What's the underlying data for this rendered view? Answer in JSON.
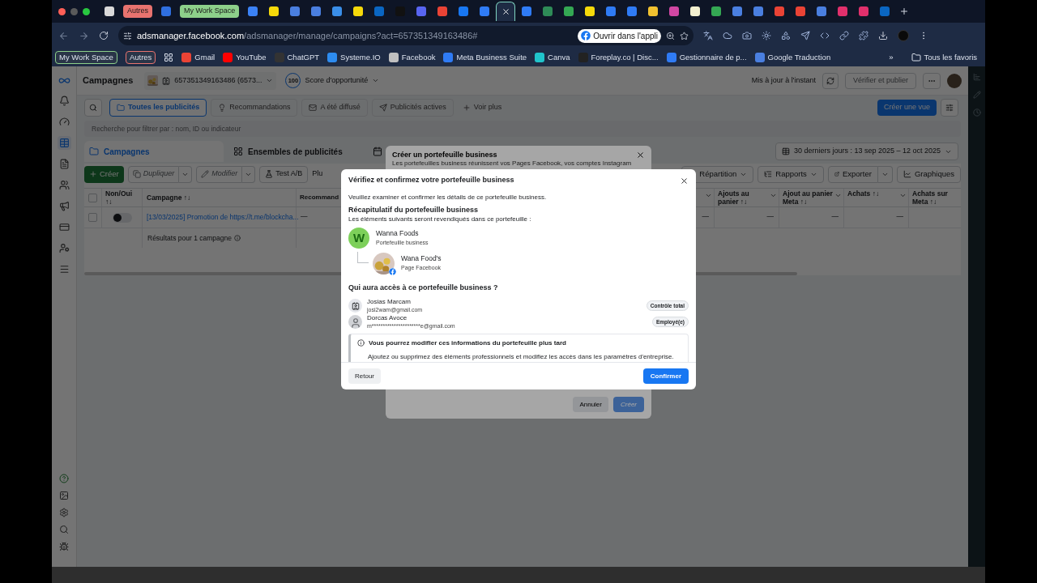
{
  "browser": {
    "tabs": [
      {
        "kind": "site",
        "color": "#d9d9d9",
        "selected": false
      },
      {
        "kind": "group",
        "label": "Autres",
        "color": "#e8736f",
        "selected": false
      },
      {
        "kind": "site",
        "color": "#2f6fe0",
        "selected": false
      },
      {
        "kind": "group",
        "label": "My Work Space",
        "color": "#8dd08a",
        "selected": false
      },
      {
        "kind": "site",
        "color": "#3b82f6",
        "selected": false
      },
      {
        "kind": "site",
        "color": "#f5d90a",
        "selected": false
      },
      {
        "kind": "site",
        "color": "#4a7fe0",
        "selected": false
      },
      {
        "kind": "site",
        "color": "#4a7fe0",
        "selected": false
      },
      {
        "kind": "site",
        "color": "#3a8ee8",
        "selected": false
      },
      {
        "kind": "site",
        "color": "#f5d90a",
        "selected": false
      },
      {
        "kind": "site",
        "color": "#0a66c2",
        "selected": false
      },
      {
        "kind": "site",
        "color": "#111111",
        "selected": false
      },
      {
        "kind": "site",
        "color": "#5865f2",
        "selected": false
      },
      {
        "kind": "site",
        "color": "#ea4335",
        "selected": false
      },
      {
        "kind": "site",
        "color": "#1877f2",
        "selected": false
      },
      {
        "kind": "site",
        "color": "#2f7bf5",
        "selected": false
      },
      {
        "kind": "site",
        "selected": true
      },
      {
        "kind": "site",
        "color": "#2f7bf5",
        "selected": false
      },
      {
        "kind": "site",
        "color": "#2e8b57",
        "selected": false
      },
      {
        "kind": "site",
        "color": "#34a853",
        "selected": false
      },
      {
        "kind": "site",
        "color": "#f5d90a",
        "selected": false
      },
      {
        "kind": "site",
        "color": "#2f7bf5",
        "selected": false
      },
      {
        "kind": "site",
        "color": "#2f7bf5",
        "selected": false
      },
      {
        "kind": "site",
        "color": "#f2c230",
        "selected": false
      },
      {
        "kind": "site",
        "color": "#d147a3",
        "selected": false
      },
      {
        "kind": "site",
        "color": "#f3f0d0",
        "selected": false
      },
      {
        "kind": "site",
        "color": "#34a853",
        "selected": false
      },
      {
        "kind": "site",
        "color": "#4a7fe0",
        "selected": false
      },
      {
        "kind": "site",
        "color": "#4a7fe0",
        "selected": false
      },
      {
        "kind": "site",
        "color": "#ea4335",
        "selected": false
      },
      {
        "kind": "site",
        "color": "#ea4335",
        "selected": false
      },
      {
        "kind": "site",
        "color": "#4a7fe0",
        "selected": false
      },
      {
        "kind": "site",
        "color": "#e1306c",
        "selected": false
      },
      {
        "kind": "site",
        "color": "#e1306c",
        "selected": false
      },
      {
        "kind": "site",
        "color": "#0a66c2",
        "selected": false
      }
    ],
    "host": "adsmanager.facebook.com",
    "path": "/adsmanager/manage/campaigns?act=657351349163486#",
    "open_app": "Ouvrir dans l'appli",
    "bookmarks": [
      {
        "kind": "group",
        "label": "My Work Space",
        "color": "#8dd08a"
      },
      {
        "kind": "group",
        "label": "Autres",
        "color": "#e8736f"
      },
      {
        "kind": "apps"
      },
      {
        "kind": "link",
        "label": "Gmail",
        "color": "#ea4335"
      },
      {
        "kind": "link",
        "label": "YouTube",
        "color": "#ff0000"
      },
      {
        "kind": "link",
        "label": "ChatGPT",
        "color": "#333333"
      },
      {
        "kind": "link",
        "label": "Systeme.IO",
        "color": "#2d8cf0"
      },
      {
        "kind": "link",
        "label": "Facebook",
        "color": "#c0c0c0"
      },
      {
        "kind": "link",
        "label": "Meta Business Suite",
        "color": "#2f7bf5"
      },
      {
        "kind": "link",
        "label": "Canva",
        "color": "#20c4cb"
      },
      {
        "kind": "link",
        "label": "Foreplay.co | Disc...",
        "color": "#222222"
      },
      {
        "kind": "link",
        "label": "Gestionnaire de p...",
        "color": "#2f7bf5"
      },
      {
        "kind": "link",
        "label": "Google Traduction",
        "color": "#4a7fe0"
      }
    ],
    "more": "»",
    "all_bookmarks": "Tous les favoris"
  },
  "ads": {
    "title": "Campagnes",
    "account": "657351349163486 (6573...",
    "score_value": "100",
    "score_label": "Score d'opportunité",
    "status": "Mis à jour à l'instant",
    "publish": "Vérifier et publier",
    "filters": [
      {
        "label": "Toutes les publicités",
        "selected": true
      },
      {
        "label": "Recommandations",
        "selected": false
      },
      {
        "label": "A été diffusé",
        "selected": false
      },
      {
        "label": "Publicités actives",
        "selected": false
      }
    ],
    "see_more": "Voir plus",
    "create_view": "Créer une vue",
    "search_placeholder": "Recherche pour filtrer par : nom, ID ou indicateur",
    "levels": [
      {
        "label": "Campagnes",
        "selected": true
      },
      {
        "label": "Ensembles de publicités",
        "selected": false
      }
    ],
    "date_range": "30 derniers jours : 13 sep 2025 – 12 oct 2025",
    "actions": [
      {
        "kind": "primary",
        "label": "Créer",
        "disabled": false
      },
      {
        "kind": "split",
        "label": "Dupliquer",
        "disabled": true
      },
      {
        "kind": "split",
        "label": "Modifier",
        "disabled": true
      },
      {
        "kind": "plain",
        "label": "Test A/B",
        "disabled": false
      },
      {
        "kind": "text",
        "label": "Plu",
        "disabled": false
      }
    ],
    "right_actions": [
      {
        "kind": "dropdown",
        "label": "Répartition"
      },
      {
        "kind": "dropdown",
        "label": "Rapports"
      },
      {
        "kind": "split",
        "label": "Exporter"
      },
      {
        "kind": "plain",
        "label": "Graphiques"
      }
    ],
    "columns": [
      "Non/Oui ↑↓",
      "Campagne ↑↓",
      "Recommand"
    ],
    "right_columns": [
      {
        "value": "—"
      },
      {
        "label": "Ajouts au panier ↑↓",
        "value": "—"
      },
      {
        "label": "Ajout au panier Meta ↑↓",
        "value": "—"
      },
      {
        "label": "Achats ↑↓",
        "value": "—"
      },
      {
        "label": "Achats sur Meta ↑↓"
      }
    ],
    "select_all_checked": false,
    "row": {
      "checked": false,
      "on": false,
      "campaign": "[13/03/2025] Promotion de https://t.me/blockcha...",
      "recommendation": "—"
    },
    "summary": "Résultats pour 1 campagne"
  },
  "dialog_back": {
    "title": "Créer un portefeuille business",
    "subtitle": "Les portefeuilles business réunissent vos Pages Facebook, vos comptes Instagram",
    "cancel": "Annuler",
    "submit": "Créer",
    "submit_disabled": true
  },
  "dialog": {
    "title": "Vérifiez et confirmez votre portefeuille business",
    "intro": "Veuillez examiner et confirmer les détails de ce portefeuille business.",
    "summary_title": "Récapitulatif du portefeuille business",
    "summary_text": "Les éléments suivants seront revendiqués dans ce portefeuille :",
    "assets": [
      {
        "kind": "business",
        "initial": "W",
        "name": "Wanna Foods",
        "type": "Portefeuille business",
        "children": [
          {
            "kind": "page",
            "name": "Wana Food's",
            "type": "Page Facebook"
          }
        ]
      }
    ],
    "access_title": "Qui aura accès à ce portefeuille business ?",
    "people": [
      {
        "kind": "badge",
        "name": "Josias Marcam",
        "email": "josi2wam@gmail.com",
        "role": "Contrôle total"
      },
      {
        "kind": "avatar",
        "name": "Dorcas Avoce",
        "email": "m**********************e@gmail.com",
        "role": "Employé(e)"
      }
    ],
    "notice_title": "Vous pourrez modifier ces informations du portefeuille plus tard",
    "notice_text": "Ajoutez ou supprimez des éléments professionnels et modifiez les accès dans les paramètres d'entreprise.",
    "back": "Retour",
    "confirm": "Confirmer"
  }
}
